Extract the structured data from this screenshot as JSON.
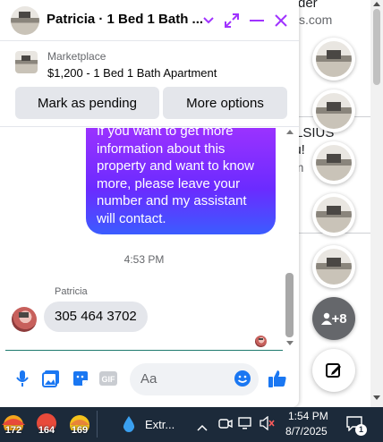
{
  "background": {
    "line1": "rder",
    "line2": "s.com",
    "line3": "ELSIUS",
    "line4": "ou!",
    "line5": "om"
  },
  "chat": {
    "title": "Patricia · 1 Bed 1 Bath ...",
    "marketplace_label": "Marketplace",
    "listing_title": "$1,200 - 1 Bed 1 Bath Apartment",
    "mark_pending_label": "Mark as pending",
    "more_options_label": "More options",
    "outgoing_message": "If you want to get more information about this property and want to know more, please leave your number and my assistant will contact.",
    "time_separator": "4:53 PM",
    "sender_name": "Patricia",
    "incoming_message": "305 464 3702",
    "input_placeholder": "Aa",
    "accent_color": "#a033ff"
  },
  "sidebar": {
    "more_count": "+8"
  },
  "taskbar": {
    "widget1": "172",
    "widget2": "164",
    "widget3": "169",
    "app_label": "Extr...",
    "time": "1:54 PM",
    "date": "8/7/2025",
    "notification_count": "1"
  }
}
